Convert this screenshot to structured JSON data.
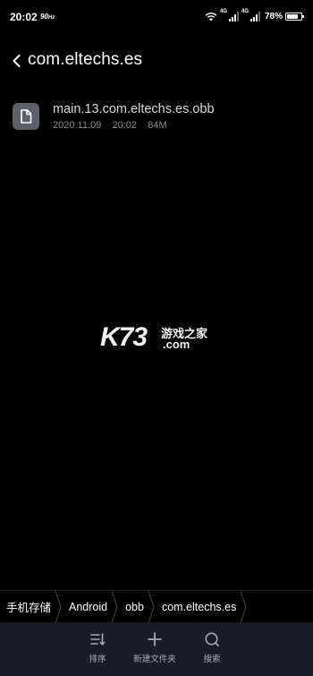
{
  "status_bar": {
    "time": "20:02",
    "fps_value": "90",
    "fps_unit": "Hz",
    "signal1_tag": "4G",
    "signal2_tag": "4G",
    "battery_text": "78%",
    "battery_level": 0.78
  },
  "header": {
    "title": "com.eltechs.es"
  },
  "files": [
    {
      "name": "main.13.com.eltechs.es.obb",
      "date": "2020.11.09",
      "time": "20:02",
      "size": "84M"
    }
  ],
  "watermark": {
    "brand": "K73",
    "chinese": "游戏之家",
    "domain": ".com"
  },
  "breadcrumb": [
    "手机存储",
    "Android",
    "obb",
    "com.eltechs.es"
  ],
  "toolbar": {
    "sort_label": "排序",
    "new_folder_label": "新建文件夹",
    "search_label": "搜索"
  },
  "colors": {
    "background": "#000000",
    "toolbar_bg": "#1a1d27",
    "file_icon_bg": "#5b6069",
    "meta_text": "#8a8a8a"
  }
}
